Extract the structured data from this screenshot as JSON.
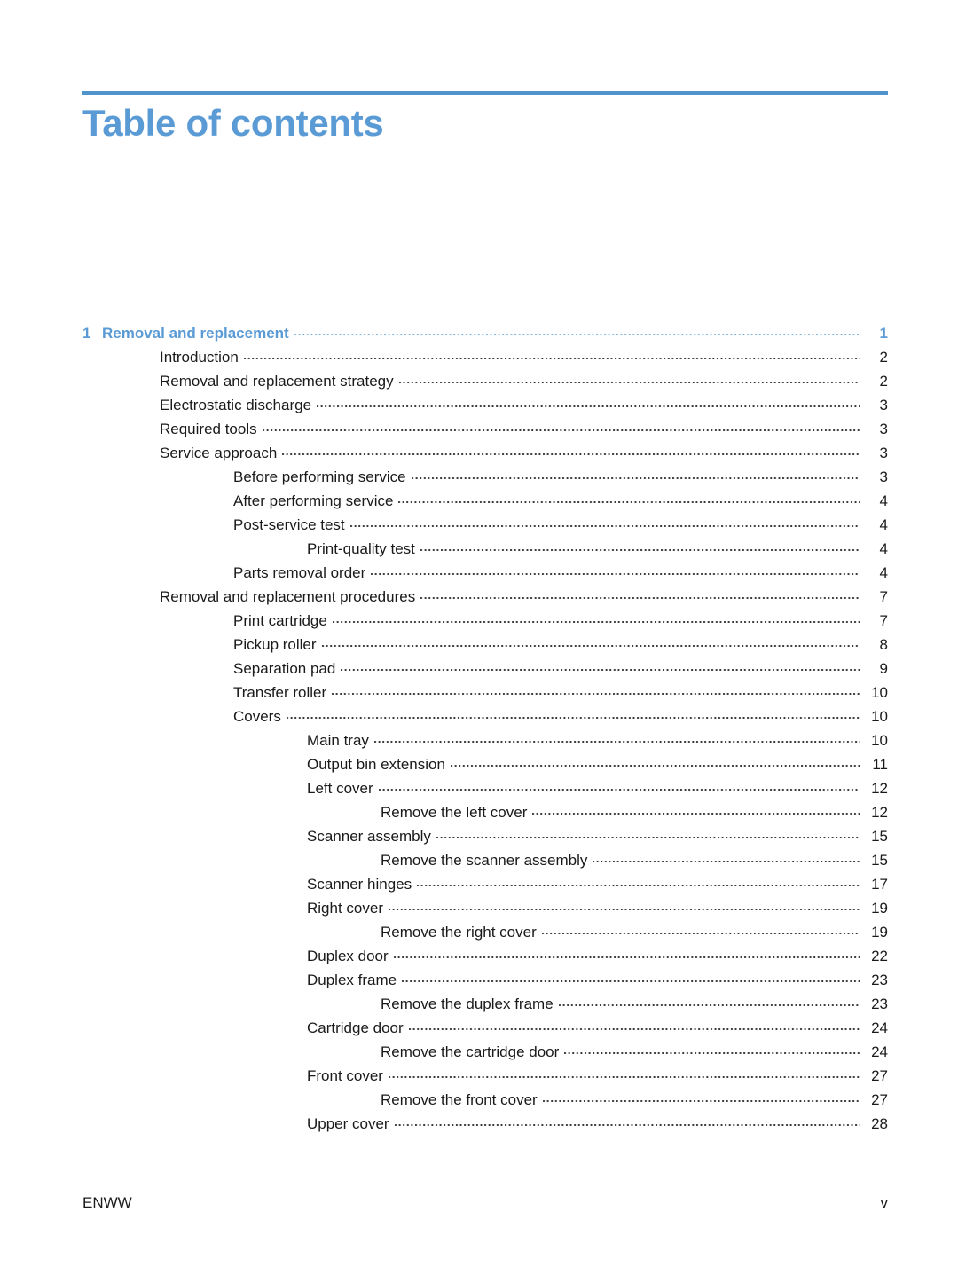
{
  "document": {
    "title": "Table of contents",
    "accent_color": "#5b9bd5",
    "rule_color": "#4f94cd"
  },
  "toc": {
    "entries": [
      {
        "level": 1,
        "number": "1",
        "label": "Removal and replacement",
        "page": "1"
      },
      {
        "level": 2,
        "number": "",
        "label": "Introduction",
        "page": "2"
      },
      {
        "level": 2,
        "number": "",
        "label": "Removal and replacement strategy",
        "page": "2"
      },
      {
        "level": 2,
        "number": "",
        "label": "Electrostatic discharge",
        "page": "3"
      },
      {
        "level": 2,
        "number": "",
        "label": "Required tools",
        "page": "3"
      },
      {
        "level": 2,
        "number": "",
        "label": "Service approach",
        "page": "3"
      },
      {
        "level": 3,
        "number": "",
        "label": "Before performing service",
        "page": "3"
      },
      {
        "level": 3,
        "number": "",
        "label": "After performing service",
        "page": "4"
      },
      {
        "level": 3,
        "number": "",
        "label": "Post-service test",
        "page": "4"
      },
      {
        "level": 4,
        "number": "",
        "label": "Print-quality test",
        "page": "4"
      },
      {
        "level": 3,
        "number": "",
        "label": "Parts removal order",
        "page": "4"
      },
      {
        "level": 2,
        "number": "",
        "label": "Removal and replacement procedures",
        "page": "7"
      },
      {
        "level": 3,
        "number": "",
        "label": "Print cartridge",
        "page": "7"
      },
      {
        "level": 3,
        "number": "",
        "label": "Pickup roller",
        "page": "8"
      },
      {
        "level": 3,
        "number": "",
        "label": "Separation pad",
        "page": "9"
      },
      {
        "level": 3,
        "number": "",
        "label": "Transfer roller",
        "page": "10"
      },
      {
        "level": 3,
        "number": "",
        "label": "Covers",
        "page": "10"
      },
      {
        "level": 4,
        "number": "",
        "label": "Main tray",
        "page": "10"
      },
      {
        "level": 4,
        "number": "",
        "label": "Output bin extension",
        "page": "11"
      },
      {
        "level": 4,
        "number": "",
        "label": "Left cover",
        "page": "12"
      },
      {
        "level": 5,
        "number": "",
        "label": "Remove the left cover",
        "page": "12"
      },
      {
        "level": 4,
        "number": "",
        "label": "Scanner assembly",
        "page": "15"
      },
      {
        "level": 5,
        "number": "",
        "label": "Remove the scanner assembly",
        "page": "15"
      },
      {
        "level": 4,
        "number": "",
        "label": "Scanner hinges",
        "page": "17"
      },
      {
        "level": 4,
        "number": "",
        "label": "Right cover",
        "page": "19"
      },
      {
        "level": 5,
        "number": "",
        "label": "Remove the right cover",
        "page": "19"
      },
      {
        "level": 4,
        "number": "",
        "label": "Duplex door",
        "page": "22"
      },
      {
        "level": 4,
        "number": "",
        "label": "Duplex frame",
        "page": "23"
      },
      {
        "level": 5,
        "number": "",
        "label": "Remove the duplex frame",
        "page": "23"
      },
      {
        "level": 4,
        "number": "",
        "label": "Cartridge door",
        "page": "24"
      },
      {
        "level": 5,
        "number": "",
        "label": "Remove the cartridge door",
        "page": "24"
      },
      {
        "level": 4,
        "number": "",
        "label": "Front cover",
        "page": "27"
      },
      {
        "level": 5,
        "number": "",
        "label": "Remove the front cover",
        "page": "27"
      },
      {
        "level": 4,
        "number": "",
        "label": "Upper cover",
        "page": "28"
      }
    ]
  },
  "footer": {
    "left": "ENWW",
    "right": "v"
  }
}
